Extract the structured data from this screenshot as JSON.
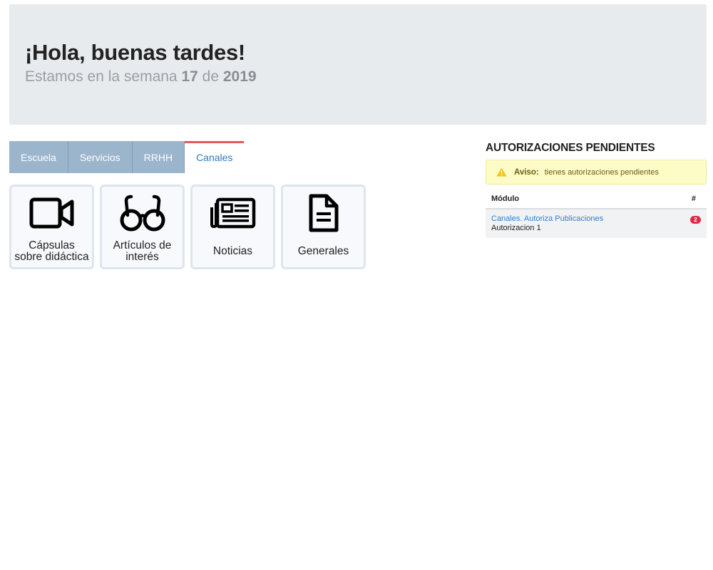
{
  "hero": {
    "title": "¡Hola, buenas tardes!",
    "sub_prefix": "Estamos en la semana ",
    "week": "17",
    "sub_mid": " de ",
    "year": "2019"
  },
  "tabs": [
    {
      "label": "Escuela"
    },
    {
      "label": "Servicios"
    },
    {
      "label": "RRHH"
    },
    {
      "label": "Canales",
      "active": true
    }
  ],
  "tiles": [
    {
      "label": "Cápsulas sobre didáctica",
      "icon": "video-camera-icon"
    },
    {
      "label": "Artículos de interés",
      "icon": "glasses-icon"
    },
    {
      "label": "Noticias",
      "icon": "newspaper-icon"
    },
    {
      "label": "Generales",
      "icon": "document-icon"
    }
  ],
  "authorizations": {
    "title": "AUTORIZACIONES PENDIENTES",
    "alert_label": "Aviso:",
    "alert_text": "tienes autorizaciones pendientes",
    "col_module": "Módulo",
    "col_count": "#",
    "rows": [
      {
        "module": "Canales. Autoriza Publicaciones",
        "detail": "Autorizacion 1",
        "count": "2"
      }
    ]
  },
  "colors": {
    "tab_bg": "#9bb5cc",
    "active_tab_border": "#e05a5a",
    "link": "#2b7fd1",
    "badge": "#e0294a",
    "alert_bg": "#fdfbc6"
  }
}
